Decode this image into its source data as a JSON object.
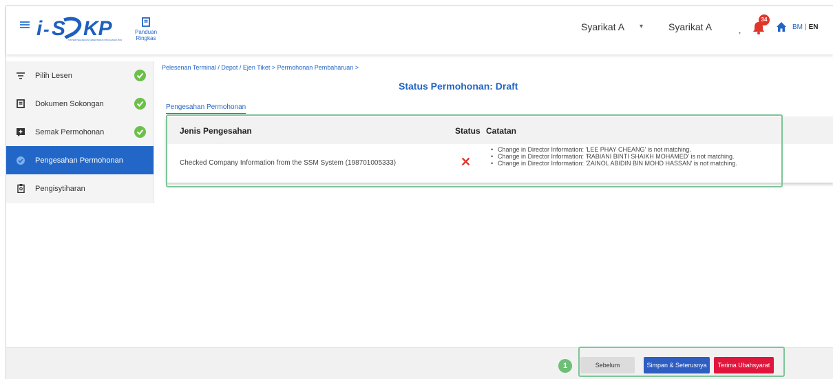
{
  "header": {
    "logo_text": "i-SPKP",
    "logo_subtitle": "SISTEM PELESENAN KEMENTERIAN PENGANGKUTAN",
    "guide_label": "Panduan Ringkas",
    "company_select": "Syarikat A",
    "company_name": "Syarikat A",
    "separator": ",",
    "notification_count": "34",
    "lang_bm": "BM",
    "lang_sep": "|",
    "lang_en": "EN"
  },
  "sidebar": {
    "items": [
      {
        "label": "Pilih Lesen",
        "icon": "filter-icon",
        "done": true
      },
      {
        "label": "Dokumen Sokongan",
        "icon": "document-icon",
        "done": true
      },
      {
        "label": "Semak Permohonan",
        "icon": "message-plus-icon",
        "done": true
      },
      {
        "label": "Pengesahan Permohonan",
        "icon": "verify-icon",
        "active": true
      },
      {
        "label": "Pengisytiharan",
        "icon": "clipboard-icon"
      }
    ]
  },
  "main": {
    "breadcrumb": "Pelesenan Terminal / Depot / Ejen Tiket > Permohonan Pembaharuan >",
    "status_title": "Status Permohonan: Draft",
    "section_title": "Pengesahan Permohonan",
    "table": {
      "headers": [
        "Jenis Pengesahan",
        "Status",
        "Catatan"
      ],
      "rows": [
        {
          "type": "Checked Company Information from the SSM System (198701005333)",
          "status_icon": "x-icon",
          "status_mark": "✕",
          "notes": [
            "Change in Director Information: 'LEE PHAY CHEANG' is not matching.",
            "Change in Director Information: 'RABIANI BINTI SHAIKH MOHAMED' is not matching.",
            "Change in Director Information: 'ZAINOL ABIDIN BIN MOHD HASSAN' is not matching."
          ]
        }
      ]
    }
  },
  "footer": {
    "step_number": "1",
    "prev_label": "Sebelum",
    "save_label": "Simpan & Seterusnya",
    "accept_label": "Terima Ubahsyarat"
  },
  "colors": {
    "primary": "#2267c8",
    "success": "#6cc04a",
    "danger": "#e0163c",
    "highlight": "#7cc597"
  }
}
